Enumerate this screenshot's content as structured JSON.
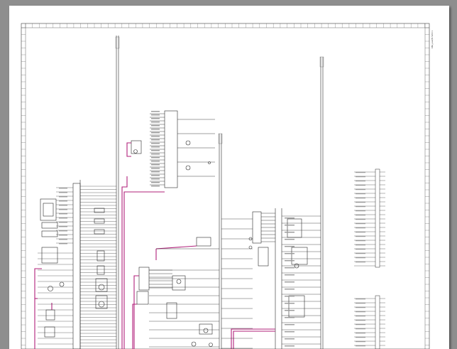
{
  "viewer": {
    "background": "#8e8e8e"
  },
  "sheet": {
    "corner_label": "KBA_eval/f1.5200 ▾",
    "colors": {
      "wire": "#2a2a2a",
      "wire_highlight": "#b0207a",
      "frame": "#3a3a3a"
    }
  }
}
